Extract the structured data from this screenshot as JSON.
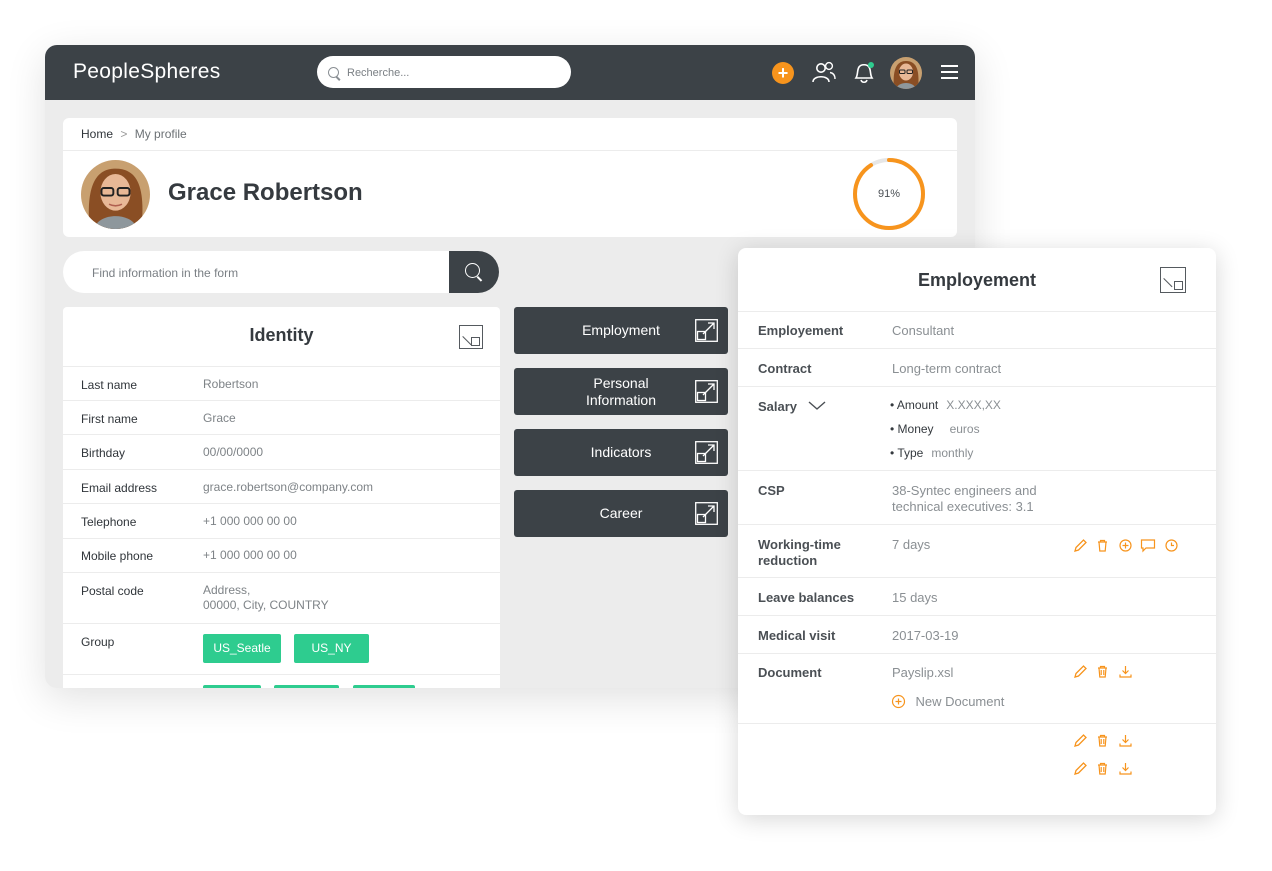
{
  "app": {
    "logo": "PeopleSpheres",
    "search_placeholder": "Recherche...",
    "accent": "#f7941d",
    "topbar_color": "#3c4247",
    "tag_color": "#2ecc8f"
  },
  "breadcrumb": {
    "home": "Home",
    "separator": ">",
    "current": "My profile"
  },
  "profile": {
    "name": "Grace Robertson",
    "completion": 91,
    "completion_label": "91%"
  },
  "form_search": {
    "placeholder": "Find information in the form"
  },
  "identity": {
    "title": "Identity",
    "rows": [
      {
        "label": "Last name",
        "value": "Robertson"
      },
      {
        "label": "First name",
        "value": "Grace"
      },
      {
        "label": "Birthday",
        "value": "00/00/0000"
      },
      {
        "label": "Email address",
        "value": "grace.robertson@company.com"
      },
      {
        "label": "Telephone",
        "value": "+1 000 000 00 00"
      },
      {
        "label": "Mobile phone",
        "value": "+1 000 000 00 00"
      },
      {
        "label": "Postal code",
        "value_line1": "Address,",
        "value_line2": "00000, City, COUNTRY"
      },
      {
        "label": "Group",
        "tags": [
          "US_Seatle",
          "US_NY"
        ]
      }
    ]
  },
  "sections": [
    {
      "label": "Employment"
    },
    {
      "label_line1": "Personal",
      "label_line2": "Information"
    },
    {
      "label": "Indicators"
    },
    {
      "label": "Career"
    }
  ],
  "employment": {
    "title": "Employement",
    "employement": {
      "label": "Employement",
      "value": "Consultant"
    },
    "contract": {
      "label": "Contract",
      "value": "Long-term contract"
    },
    "salary": {
      "label": "Salary",
      "amount_key": "• Amount",
      "amount_value": "X.XXX,XX",
      "money_key": "• Money",
      "money_value": "euros",
      "type_key": "• Type",
      "type_value": "monthly"
    },
    "csp": {
      "label": "CSP",
      "value_line1": "38-Syntec engineers and",
      "value_line2": "technical executives: 3.1"
    },
    "working_time": {
      "label_line1": "Working-time",
      "label_line2": "reduction",
      "value": "7 days"
    },
    "leave": {
      "label": "Leave balances",
      "value": "15 days"
    },
    "medical": {
      "label": "Medical visit",
      "value": "2017-03-19"
    },
    "document": {
      "label": "Document",
      "value": "Payslip.xsl",
      "new_label": "New Document"
    }
  }
}
